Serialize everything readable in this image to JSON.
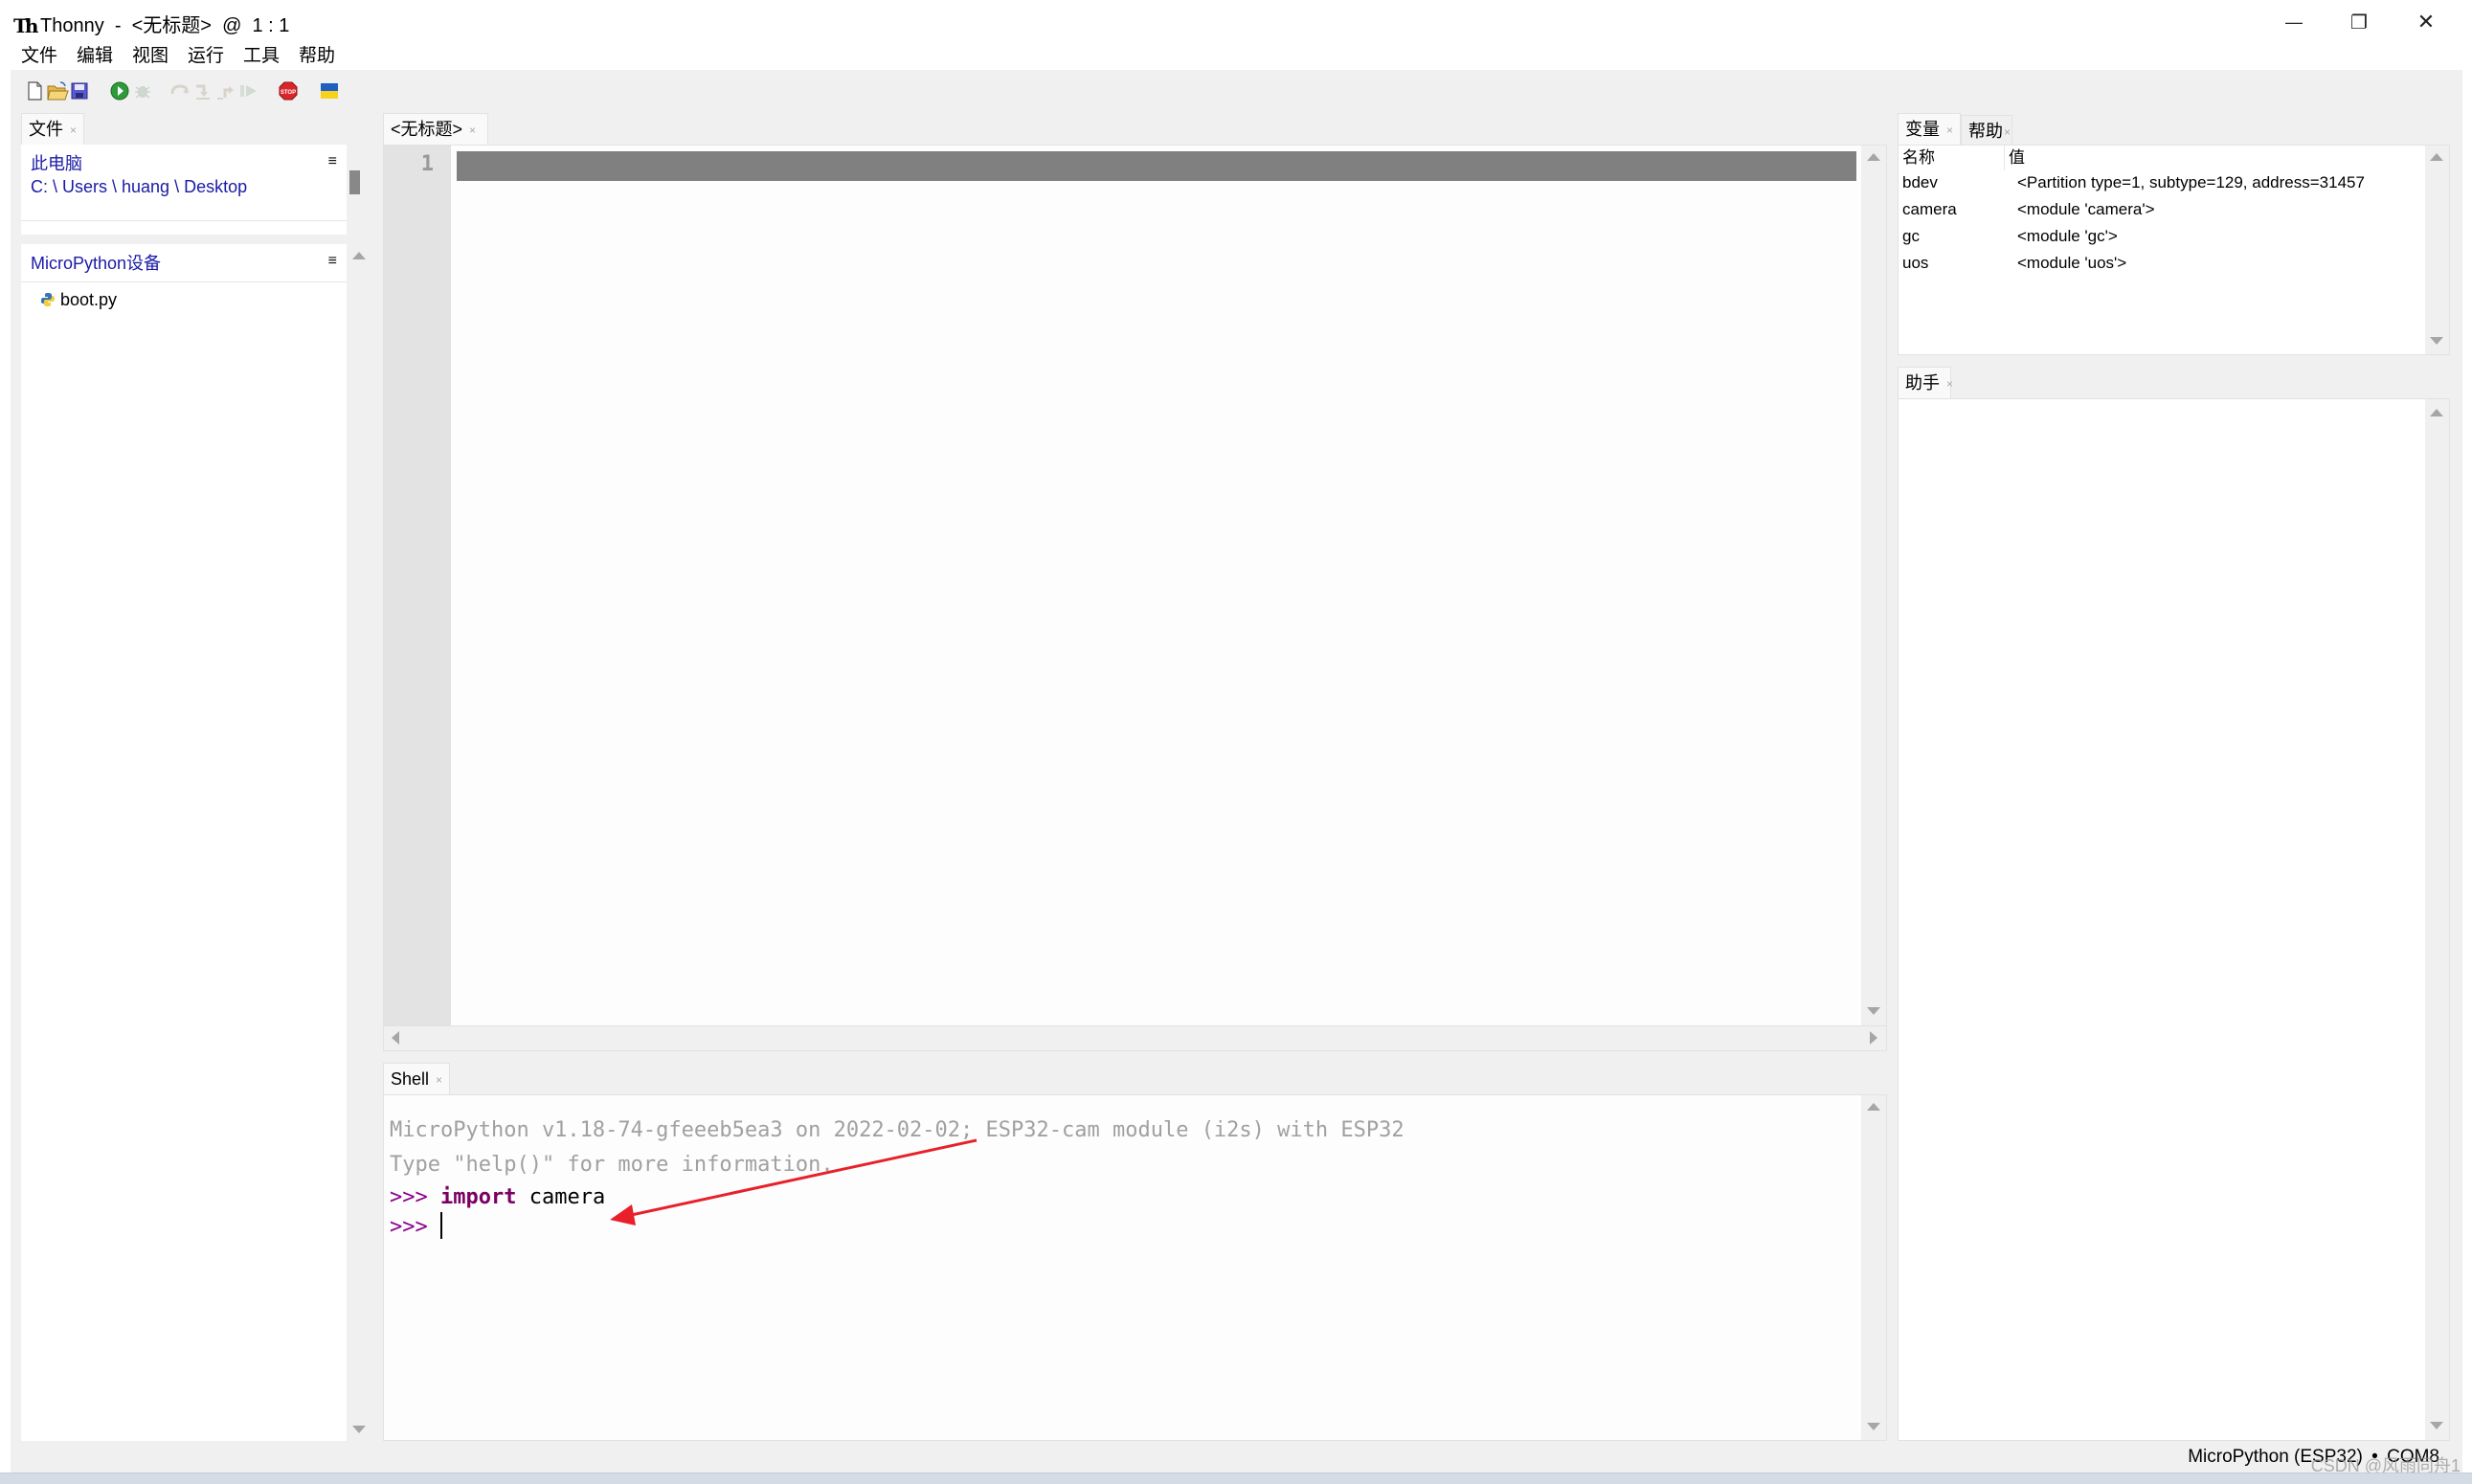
{
  "window": {
    "app_name": "Thonny",
    "title": "Thonny  -  <无标题>  @  1 : 1",
    "controls": {
      "minimize": "—",
      "restore": "❐",
      "close": "✕"
    }
  },
  "menu": [
    "文件",
    "编辑",
    "视图",
    "运行",
    "工具",
    "帮助"
  ],
  "toolbar": {
    "buttons": [
      {
        "name": "new-file",
        "enabled": true
      },
      {
        "name": "open-file",
        "enabled": true
      },
      {
        "name": "save-file",
        "enabled": true
      },
      {
        "name": "run",
        "enabled": true
      },
      {
        "name": "debug",
        "enabled": false
      },
      {
        "name": "step-over",
        "enabled": false
      },
      {
        "name": "step-into",
        "enabled": false
      },
      {
        "name": "step-out",
        "enabled": false
      },
      {
        "name": "resume",
        "enabled": false
      },
      {
        "name": "stop",
        "enabled": true,
        "label": "STOP"
      },
      {
        "name": "support-ukraine",
        "enabled": true
      }
    ]
  },
  "files_panel": {
    "tab_label": "文件",
    "this_computer": {
      "header": "此电脑",
      "path": "C: \\ Users \\ huang \\ Desktop",
      "menu_icon": "≡"
    },
    "device": {
      "header": "MicroPython设备",
      "menu_icon": "≡",
      "files": [
        {
          "name": "boot.py",
          "icon": "python-file-icon"
        }
      ]
    }
  },
  "editor": {
    "tab_label": "<无标题>",
    "line_numbers": [
      "1"
    ],
    "content": ""
  },
  "shell": {
    "tab_label": "Shell",
    "lines": [
      {
        "type": "info",
        "text": "MicroPython v1.18-74-gfeeeb5ea3 on 2022-02-02; ESP32-cam module (i2s) with ESP32"
      },
      {
        "type": "info",
        "text": "Type \"help()\" for more information."
      },
      {
        "type": "input",
        "prompt": ">>> ",
        "keyword": "import",
        "rest": " camera"
      },
      {
        "type": "input",
        "prompt": ">>> ",
        "keyword": "",
        "rest": ""
      }
    ]
  },
  "variables_panel": {
    "tab_label": "变量",
    "help_tab_label": "帮助",
    "columns": [
      "名称",
      "值"
    ],
    "rows": [
      {
        "name": "bdev",
        "value": "<Partition type=1, subtype=129, address=31457"
      },
      {
        "name": "camera",
        "value": "<module 'camera'>"
      },
      {
        "name": "gc",
        "value": "<module 'gc'>"
      },
      {
        "name": "uos",
        "value": "<module 'uos'>"
      }
    ]
  },
  "assistant_panel": {
    "tab_label": "助手",
    "content": ""
  },
  "status_bar": {
    "interpreter": "MicroPython (ESP32)",
    "separator": "•",
    "port": "COM8"
  },
  "watermark": "CSDN @风雨同舟1",
  "annotation": {
    "type": "arrow",
    "color": "#e8202a",
    "points_to": "import camera"
  }
}
